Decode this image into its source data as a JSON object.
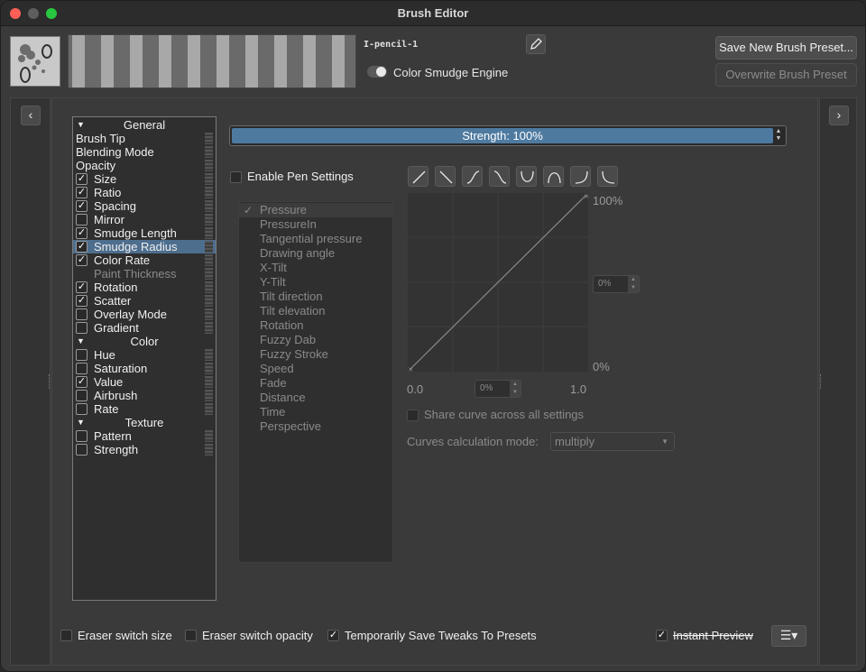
{
  "window": {
    "title": "Brush Editor"
  },
  "preset": {
    "name": "I-pencil-1",
    "engine_label": "Color Smudge Engine",
    "thumbnail_icon": "pencil-texture-icon",
    "edit_icon": "pencil-icon"
  },
  "buttons": {
    "save_new": "Save New Brush Preset...",
    "overwrite": "Overwrite Brush Preset"
  },
  "options": [
    {
      "type": "header",
      "label": "General"
    },
    {
      "type": "plain",
      "label": "Brush Tip"
    },
    {
      "type": "plain",
      "label": "Blending Mode"
    },
    {
      "type": "plain",
      "label": "Opacity"
    },
    {
      "type": "check",
      "label": "Size",
      "checked": true
    },
    {
      "type": "check",
      "label": "Ratio",
      "checked": true
    },
    {
      "type": "check",
      "label": "Spacing",
      "checked": true
    },
    {
      "type": "check",
      "label": "Mirror",
      "checked": false
    },
    {
      "type": "check",
      "label": "Smudge Length",
      "checked": true
    },
    {
      "type": "check",
      "label": "Smudge Radius",
      "checked": true,
      "selected": true
    },
    {
      "type": "check",
      "label": "Color Rate",
      "checked": true
    },
    {
      "type": "disabled",
      "label": "Paint Thickness"
    },
    {
      "type": "check",
      "label": "Rotation",
      "checked": true
    },
    {
      "type": "check",
      "label": "Scatter",
      "checked": true
    },
    {
      "type": "check",
      "label": "Overlay Mode",
      "checked": false
    },
    {
      "type": "check",
      "label": "Gradient",
      "checked": false
    },
    {
      "type": "header",
      "label": "Color"
    },
    {
      "type": "check",
      "label": "Hue",
      "checked": false
    },
    {
      "type": "check",
      "label": "Saturation",
      "checked": false
    },
    {
      "type": "check",
      "label": "Value",
      "checked": true
    },
    {
      "type": "check",
      "label": "Airbrush",
      "checked": false
    },
    {
      "type": "check",
      "label": "Rate",
      "checked": false
    },
    {
      "type": "header",
      "label": "Texture"
    },
    {
      "type": "check",
      "label": "Pattern",
      "checked": false
    },
    {
      "type": "check",
      "label": "Strength",
      "checked": false
    }
  ],
  "strength": {
    "label": "Strength: 100%",
    "value": 100
  },
  "pen_settings": {
    "label": "Enable Pen Settings",
    "checked": false
  },
  "sensors": [
    {
      "label": "Pressure",
      "active": true
    },
    {
      "label": "PressureIn"
    },
    {
      "label": "Tangential pressure"
    },
    {
      "label": "Drawing angle"
    },
    {
      "label": "X-Tilt"
    },
    {
      "label": "Y-Tilt"
    },
    {
      "label": "Tilt direction"
    },
    {
      "label": "Tilt elevation"
    },
    {
      "label": "Rotation"
    },
    {
      "label": "Fuzzy Dab"
    },
    {
      "label": "Fuzzy Stroke"
    },
    {
      "label": "Speed"
    },
    {
      "label": "Fade"
    },
    {
      "label": "Distance"
    },
    {
      "label": "Time"
    },
    {
      "label": "Perspective"
    }
  ],
  "curve_presets": [
    "linear-up-icon",
    "linear-down-icon",
    "s-curve-icon",
    "reverse-s-curve-icon",
    "u-curve-icon",
    "arch-curve-icon",
    "ease-in-icon",
    "ease-out-icon"
  ],
  "curve": {
    "y_max_label": "100%",
    "y_min_label": "0%",
    "x_min_label": "0.0",
    "x_max_label": "1.0",
    "y_spin_value": "0%",
    "x_spin_value": "0%"
  },
  "share_curve": {
    "label": "Share curve across all settings",
    "checked": false
  },
  "calc_mode": {
    "label": "Curves calculation mode:",
    "value": "multiply"
  },
  "bottom": {
    "eraser_size": {
      "label": "Eraser switch size",
      "checked": false
    },
    "eraser_opacity": {
      "label": "Eraser switch opacity",
      "checked": false
    },
    "temp_save": {
      "label": "Temporarily Save Tweaks To Presets",
      "checked": true
    },
    "instant_preview": {
      "label": "Instant Preview",
      "checked": true
    }
  },
  "colors": {
    "accent": "#4e7aa0",
    "selection": "#4e6e8e",
    "close": "#ff5f57",
    "maximize": "#28c840"
  }
}
